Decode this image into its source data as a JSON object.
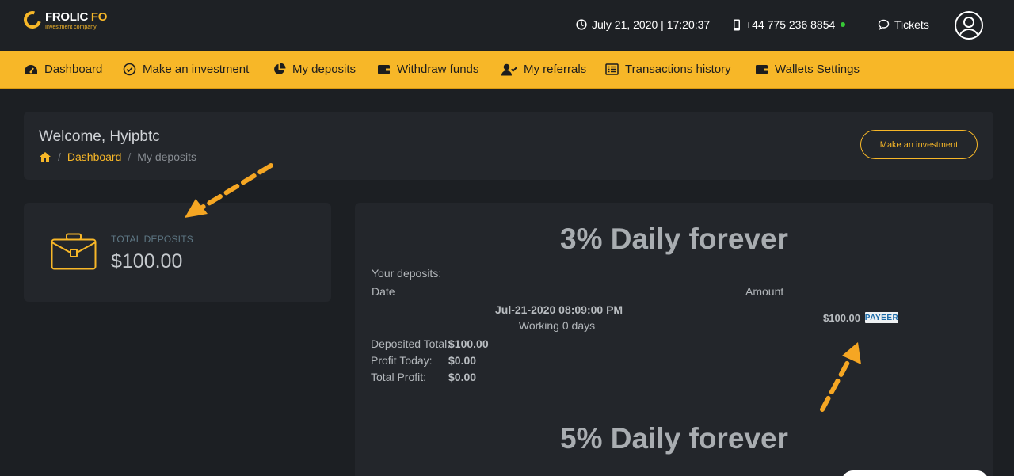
{
  "header": {
    "logo_name_1": "FROLIC",
    "logo_name_2": " FO",
    "logo_sub": "Investment company",
    "datetime": "July 21, 2020 | 17:20:37",
    "phone": "+44 775 236 8854",
    "tickets_label": "Tickets"
  },
  "nav": {
    "items": [
      {
        "label": "Dashboard",
        "icon": "dashboard-icon"
      },
      {
        "label": "Make an investment",
        "icon": "check-circle-icon"
      },
      {
        "label": "My deposits",
        "icon": "pie-chart-icon"
      },
      {
        "label": "Withdraw funds",
        "icon": "wallet-icon"
      },
      {
        "label": "My referrals",
        "icon": "user-check-icon"
      },
      {
        "label": "Transactions history",
        "icon": "list-icon"
      },
      {
        "label": "Wallets Settings",
        "icon": "wallet-icon"
      }
    ]
  },
  "welcome": {
    "title": "Welcome, Hyipbtc",
    "breadcrumb_sep": "/",
    "breadcrumb_link": "Dashboard",
    "breadcrumb_current": "My deposits",
    "button_label": "Make an investment"
  },
  "total": {
    "label": "TOTAL DEPOSITS",
    "value": "$100.00"
  },
  "plans": [
    {
      "title": "3% Daily forever",
      "your_deposits_label": "Your deposits:",
      "date_header": "Date",
      "amount_header": "Amount",
      "deposit_date": "Jul-21-2020 08:09:00 PM",
      "working": "Working 0 days",
      "deposit_amount": "$100.00",
      "payment_badge": "PAYEER",
      "deposited_total_label": "Deposited Total:",
      "deposited_total_value": "$100.00",
      "profit_today_label": "Profit Today:",
      "profit_today_value": "$0.00",
      "total_profit_label": "Total Profit:",
      "total_profit_value": "$0.00"
    },
    {
      "title": "5% Daily forever"
    }
  ],
  "colors": {
    "accent": "#f7b728",
    "background": "#1c1f23",
    "card": "#23262b",
    "online": "#37c936"
  }
}
